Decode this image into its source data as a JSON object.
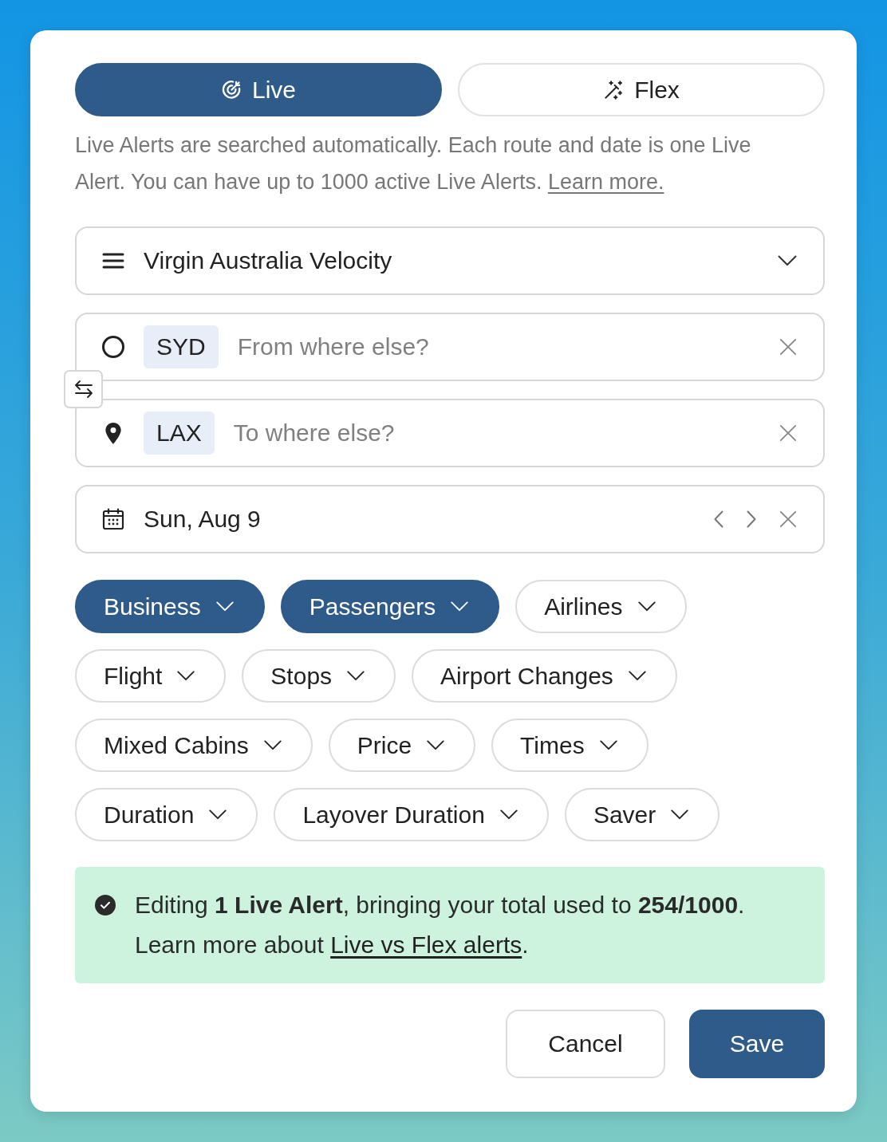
{
  "modes": [
    {
      "label": "Live",
      "selected": true
    },
    {
      "label": "Flex",
      "selected": false
    }
  ],
  "description": {
    "text": "Live Alerts are searched automatically. Each route and date is one Live Alert. You can have up to 1000 active Live Alerts.",
    "link": "Learn more."
  },
  "program_select": {
    "value": "Virgin Australia Velocity"
  },
  "origin": {
    "code": "SYD",
    "placeholder": "From where else?"
  },
  "destination": {
    "code": "LAX",
    "placeholder": "To where else?"
  },
  "date": {
    "value": "Sun, Aug 9"
  },
  "filters": [
    {
      "label": "Business",
      "selected": true
    },
    {
      "label": "Passengers",
      "selected": true
    },
    {
      "label": "Airlines",
      "selected": false
    },
    {
      "label": "Flight",
      "selected": false
    },
    {
      "label": "Stops",
      "selected": false
    },
    {
      "label": "Airport Changes",
      "selected": false
    },
    {
      "label": "Mixed Cabins",
      "selected": false
    },
    {
      "label": "Price",
      "selected": false
    },
    {
      "label": "Times",
      "selected": false
    },
    {
      "label": "Duration",
      "selected": false
    },
    {
      "label": "Layover Duration",
      "selected": false
    },
    {
      "label": "Saver",
      "selected": false
    }
  ],
  "info": {
    "summary": "Editing **1 Live Alert**, bringing your total used to **254/1000**.",
    "learn_more": {
      "text": "Learn more about",
      "link": "Live vs Flex alerts",
      "after": "."
    }
  },
  "buttons": [
    {
      "label": "Cancel",
      "kind": "secondary"
    },
    {
      "label": "Save",
      "kind": "primary"
    }
  ]
}
